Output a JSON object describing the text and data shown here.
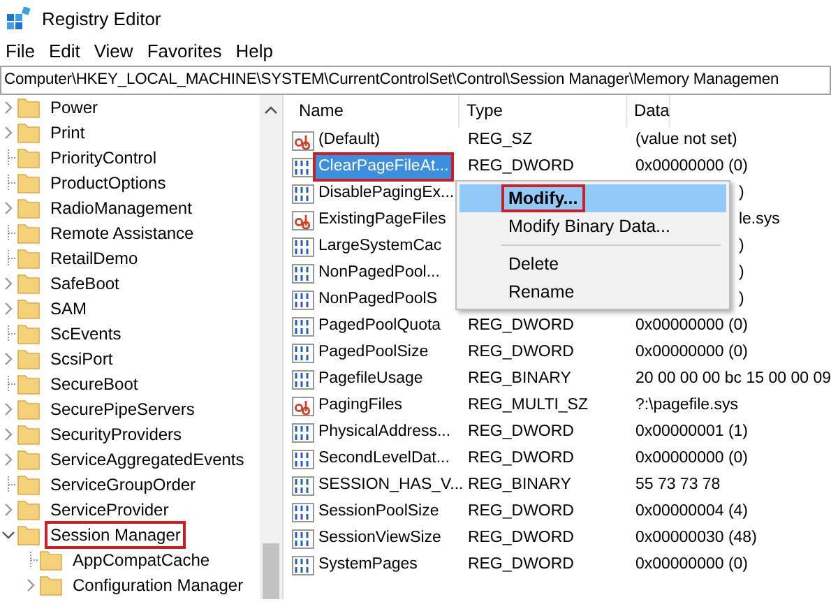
{
  "window": {
    "title": "Registry Editor"
  },
  "menu": [
    "File",
    "Edit",
    "View",
    "Favorites",
    "Help"
  ],
  "address": "Computer\\HKEY_LOCAL_MACHINE\\SYSTEM\\CurrentControlSet\\Control\\Session Manager\\Memory Managemen",
  "tree": [
    {
      "label": "Power",
      "expandable": true,
      "expanded": false,
      "highlighted": false
    },
    {
      "label": "Print",
      "expandable": true,
      "expanded": false,
      "highlighted": false
    },
    {
      "label": "PriorityControl",
      "expandable": false,
      "expanded": false,
      "highlighted": false
    },
    {
      "label": "ProductOptions",
      "expandable": false,
      "expanded": false,
      "highlighted": false
    },
    {
      "label": "RadioManagement",
      "expandable": true,
      "expanded": false,
      "highlighted": false
    },
    {
      "label": "Remote Assistance",
      "expandable": false,
      "expanded": false,
      "highlighted": false
    },
    {
      "label": "RetailDemo",
      "expandable": false,
      "expanded": false,
      "highlighted": false
    },
    {
      "label": "SafeBoot",
      "expandable": true,
      "expanded": false,
      "highlighted": false
    },
    {
      "label": "SAM",
      "expandable": true,
      "expanded": false,
      "highlighted": false
    },
    {
      "label": "ScEvents",
      "expandable": false,
      "expanded": false,
      "highlighted": false
    },
    {
      "label": "ScsiPort",
      "expandable": true,
      "expanded": false,
      "highlighted": false
    },
    {
      "label": "SecureBoot",
      "expandable": false,
      "expanded": false,
      "highlighted": false
    },
    {
      "label": "SecurePipeServers",
      "expandable": true,
      "expanded": false,
      "highlighted": false
    },
    {
      "label": "SecurityProviders",
      "expandable": true,
      "expanded": false,
      "highlighted": false
    },
    {
      "label": "ServiceAggregatedEvents",
      "expandable": true,
      "expanded": false,
      "highlighted": false
    },
    {
      "label": "ServiceGroupOrder",
      "expandable": false,
      "expanded": false,
      "highlighted": false
    },
    {
      "label": "ServiceProvider",
      "expandable": true,
      "expanded": false,
      "highlighted": false
    },
    {
      "label": "Session Manager",
      "expandable": true,
      "expanded": true,
      "highlighted": true,
      "children": [
        {
          "label": "AppCompatCache",
          "expandable": false,
          "expanded": false,
          "highlighted": false
        },
        {
          "label": "Configuration Manager",
          "expandable": true,
          "expanded": false,
          "highlighted": false
        }
      ]
    }
  ],
  "columns": [
    "Name",
    "Type",
    "Data"
  ],
  "values": [
    {
      "kind": "string",
      "name": "(Default)",
      "type": "REG_SZ",
      "data": "(value not set)",
      "selected": false,
      "highlighted": false,
      "covered": false
    },
    {
      "kind": "binary",
      "name": "ClearPageFileAt...",
      "type": "REG_DWORD",
      "data": "0x00000000 (0)",
      "selected": true,
      "highlighted": true,
      "covered": false
    },
    {
      "kind": "binary",
      "name": "DisablePagingEx...",
      "data": ")",
      "selected": false,
      "highlighted": false,
      "covered": true
    },
    {
      "kind": "string",
      "name": "ExistingPageFiles",
      "data": "le.sys",
      "selected": false,
      "highlighted": false,
      "covered": true
    },
    {
      "kind": "binary",
      "name": "LargeSystemCac",
      "data": ")",
      "selected": false,
      "highlighted": false,
      "covered": true
    },
    {
      "kind": "binary",
      "name": "NonPagedPool...",
      "data": ")",
      "selected": false,
      "highlighted": false,
      "covered": true
    },
    {
      "kind": "binary",
      "name": "NonPagedPoolS",
      "data": ")",
      "selected": false,
      "highlighted": false,
      "covered": true
    },
    {
      "kind": "binary",
      "name": "PagedPoolQuota",
      "type": "REG_DWORD",
      "data": "0x00000000 (0)",
      "selected": false,
      "highlighted": false,
      "covered": false
    },
    {
      "kind": "binary",
      "name": "PagedPoolSize",
      "type": "REG_DWORD",
      "data": "0x00000000 (0)",
      "selected": false,
      "highlighted": false,
      "covered": false
    },
    {
      "kind": "binary",
      "name": "PagefileUsage",
      "type": "REG_BINARY",
      "data": "20 00 00 00 bc 15 00 00 09",
      "selected": false,
      "highlighted": false,
      "covered": false
    },
    {
      "kind": "string",
      "name": "PagingFiles",
      "type": "REG_MULTI_SZ",
      "data": "?:\\pagefile.sys",
      "selected": false,
      "highlighted": false,
      "covered": false
    },
    {
      "kind": "binary",
      "name": "PhysicalAddress...",
      "type": "REG_DWORD",
      "data": "0x00000001 (1)",
      "selected": false,
      "highlighted": false,
      "covered": false
    },
    {
      "kind": "binary",
      "name": "SecondLevelDat...",
      "type": "REG_DWORD",
      "data": "0x00000000 (0)",
      "selected": false,
      "highlighted": false,
      "covered": false
    },
    {
      "kind": "binary",
      "name": "SESSION_HAS_V...",
      "type": "REG_BINARY",
      "data": "55 73 73 78",
      "selected": false,
      "highlighted": false,
      "covered": false
    },
    {
      "kind": "binary",
      "name": "SessionPoolSize",
      "type": "REG_DWORD",
      "data": "0x00000004 (4)",
      "selected": false,
      "highlighted": false,
      "covered": false
    },
    {
      "kind": "binary",
      "name": "SessionViewSize",
      "type": "REG_DWORD",
      "data": "0x00000030 (48)",
      "selected": false,
      "highlighted": false,
      "covered": false
    },
    {
      "kind": "binary",
      "name": "SystemPages",
      "type": "REG_DWORD",
      "data": "0x00000000 (0)",
      "selected": false,
      "highlighted": false,
      "covered": false
    }
  ],
  "context_menu": [
    {
      "kind": "item",
      "label": "Modify...",
      "bold": true,
      "selected": true,
      "highlighted": true
    },
    {
      "kind": "item",
      "label": "Modify Binary Data...",
      "bold": false,
      "selected": false,
      "highlighted": false
    },
    {
      "kind": "separator"
    },
    {
      "kind": "item",
      "label": "Delete",
      "bold": false,
      "selected": false,
      "highlighted": false
    },
    {
      "kind": "item",
      "label": "Rename",
      "bold": false,
      "selected": false,
      "highlighted": false
    }
  ]
}
